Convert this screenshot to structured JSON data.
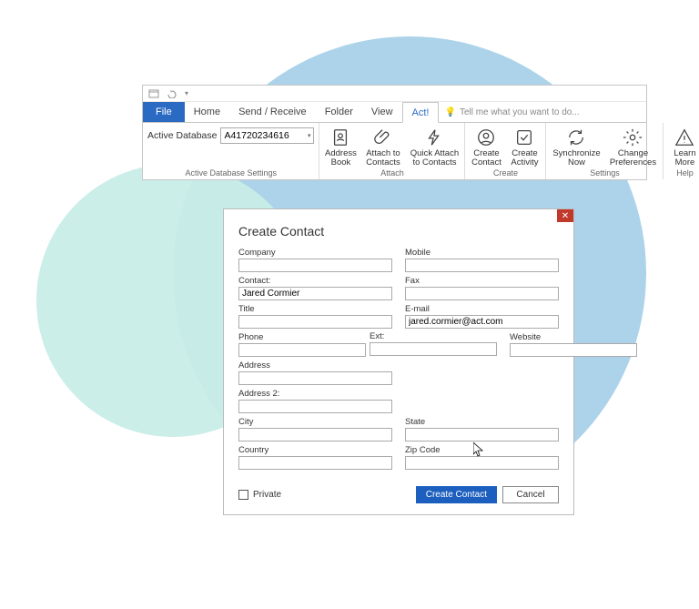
{
  "ribbon": {
    "tabs": {
      "file": "File",
      "home": "Home",
      "send_receive": "Send / Receive",
      "folder": "Folder",
      "view": "View",
      "act": "Act!"
    },
    "tell_me": "Tell me what you want to do...",
    "active_db_label": "Active Database",
    "active_db_value": "A41720234616",
    "groups": {
      "active_db": "Active Database Settings",
      "attach": "Attach",
      "create": "Create",
      "settings": "Settings",
      "help": "Help"
    },
    "buttons": {
      "address_book": "Address Book",
      "attach_contacts": "Attach to Contacts",
      "quick_attach": "Quick Attach to Contacts",
      "create_contact": "Create Contact",
      "create_activity": "Create Activity",
      "sync_now": "Synchronize Now",
      "change_prefs": "Change Preferences",
      "learn_more": "Learn More"
    }
  },
  "dialog": {
    "title": "Create Contact",
    "labels": {
      "company": "Company",
      "contact": "Contact:",
      "title": "Title",
      "phone": "Phone",
      "ext": "Ext:",
      "address": "Address",
      "address2": "Address 2:",
      "city": "City",
      "country": "Country",
      "mobile": "Mobile",
      "fax": "Fax",
      "email": "E-mail",
      "website": "Website",
      "state": "State",
      "zip": "Zip Code",
      "private": "Private"
    },
    "values": {
      "company": "",
      "contact": "Jared Cormier",
      "title": "",
      "phone": "",
      "ext": "",
      "address": "",
      "address2": "",
      "city": "",
      "country": "",
      "mobile": "",
      "fax": "",
      "email": "jared.cormier@act.com",
      "website": "",
      "state": "",
      "zip": ""
    },
    "buttons": {
      "create": "Create Contact",
      "cancel": "Cancel"
    }
  }
}
